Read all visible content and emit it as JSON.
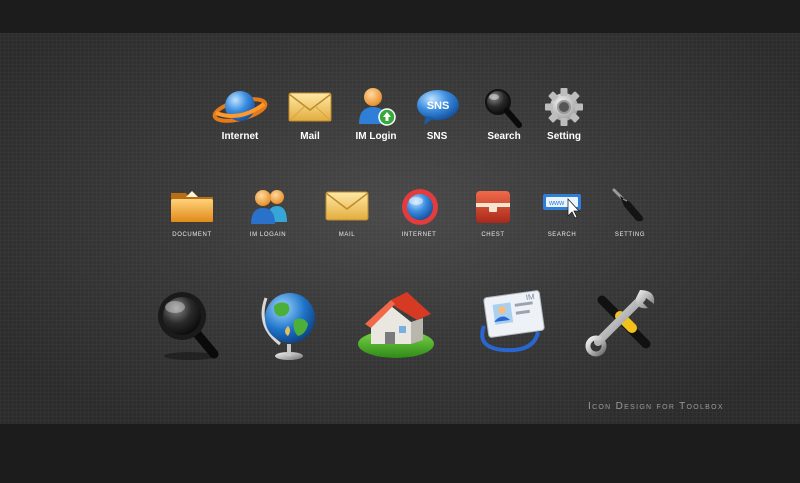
{
  "row1": {
    "items": [
      {
        "label": "Internet",
        "icon": "planet-icon"
      },
      {
        "label": "Mail",
        "icon": "envelope-icon"
      },
      {
        "label": "IM Login",
        "icon": "user-upload-icon"
      },
      {
        "label": "SNS",
        "icon": "speech-bubble-icon"
      },
      {
        "label": "Search",
        "icon": "magnifier-icon"
      },
      {
        "label": "Setting",
        "icon": "gear-icon"
      }
    ]
  },
  "row2": {
    "items": [
      {
        "label": "DOCUMENT",
        "icon": "folder-icon"
      },
      {
        "label": "IM LOGAIN",
        "icon": "users-icon"
      },
      {
        "label": "MAIL",
        "icon": "envelope-icon"
      },
      {
        "label": "INTERNET",
        "icon": "globe-ring-icon"
      },
      {
        "label": "CHEST",
        "icon": "chest-icon"
      },
      {
        "label": "SEARCH",
        "icon": "search-bar-icon"
      },
      {
        "label": "SETTING",
        "icon": "screwdriver-icon"
      }
    ]
  },
  "row3": {
    "items": [
      {
        "icon": "magnifying-glass-icon"
      },
      {
        "icon": "globe-icon"
      },
      {
        "icon": "home-icon"
      },
      {
        "icon": "id-badge-icon"
      },
      {
        "icon": "tools-icon"
      }
    ]
  },
  "footer": {
    "caption": "Icon Design for Toolbox"
  }
}
